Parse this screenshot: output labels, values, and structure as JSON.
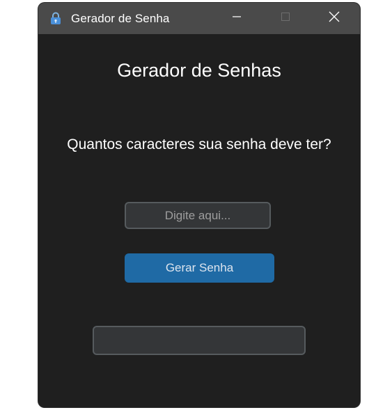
{
  "window": {
    "title": "Gerador de Senha",
    "icon": "lock-icon",
    "controls": [
      "minimize-icon",
      "maximize-icon",
      "close-icon"
    ]
  },
  "main": {
    "heading": "Gerador de Senhas",
    "question": "Quantos caracteres  sua senha deve ter?",
    "length_input": {
      "value": "",
      "placeholder": "Digite aqui..."
    },
    "generate_button": "Gerar Senha",
    "result_field": {
      "value": ""
    }
  },
  "colors": {
    "window_bg": "#1f1f1f",
    "titlebar_bg": "#4a4a4a",
    "input_bg": "#343638",
    "input_border": "#565b5e",
    "button_bg": "#1f6aa5",
    "text": "#ffffff",
    "placeholder": "#9e9e9e"
  }
}
